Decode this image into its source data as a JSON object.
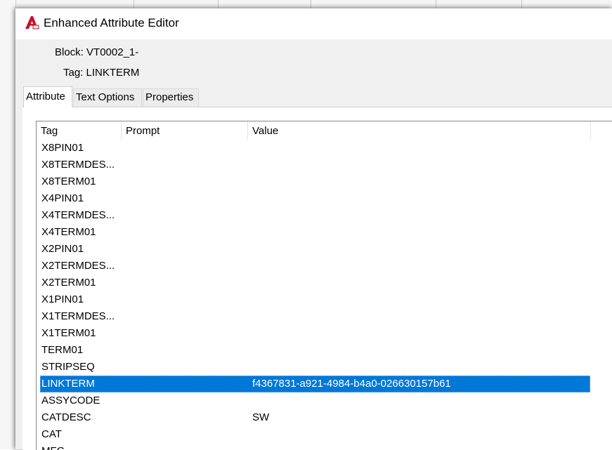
{
  "window": {
    "title": "Enhanced Attribute Editor",
    "app_icon": "autocad-icon"
  },
  "info": {
    "block_label": "Block:",
    "block_value": "VT0002_1-",
    "tag_label": "Tag:",
    "tag_value": "LINKTERM"
  },
  "tabs": [
    {
      "label": "Attribute",
      "active": true
    },
    {
      "label": "Text Options",
      "active": false
    },
    {
      "label": "Properties",
      "active": false
    }
  ],
  "table": {
    "columns": [
      "Tag",
      "Prompt",
      "Value"
    ],
    "rows": [
      {
        "tag": "X8PIN01",
        "prompt": "",
        "value": ""
      },
      {
        "tag": "X8TERMDES...",
        "prompt": "",
        "value": ""
      },
      {
        "tag": "X8TERM01",
        "prompt": "",
        "value": ""
      },
      {
        "tag": "X4PIN01",
        "prompt": "",
        "value": ""
      },
      {
        "tag": "X4TERMDES...",
        "prompt": "",
        "value": ""
      },
      {
        "tag": "X4TERM01",
        "prompt": "",
        "value": ""
      },
      {
        "tag": "X2PIN01",
        "prompt": "",
        "value": ""
      },
      {
        "tag": "X2TERMDES...",
        "prompt": "",
        "value": ""
      },
      {
        "tag": "X2TERM01",
        "prompt": "",
        "value": ""
      },
      {
        "tag": "X1PIN01",
        "prompt": "",
        "value": ""
      },
      {
        "tag": "X1TERMDES...",
        "prompt": "",
        "value": ""
      },
      {
        "tag": "X1TERM01",
        "prompt": "",
        "value": ""
      },
      {
        "tag": "TERM01",
        "prompt": "",
        "value": ""
      },
      {
        "tag": "STRIPSEQ",
        "prompt": "",
        "value": ""
      },
      {
        "tag": "LINKTERM",
        "prompt": "",
        "value": "f4367831-a921-4984-b4a0-026630157b61",
        "selected": true
      },
      {
        "tag": "ASSYCODE",
        "prompt": "",
        "value": ""
      },
      {
        "tag": "CATDESC",
        "prompt": "",
        "value": "SW"
      },
      {
        "tag": "CAT",
        "prompt": "",
        "value": ""
      },
      {
        "tag": "MFG",
        "prompt": "",
        "value": ""
      }
    ]
  },
  "colors": {
    "selection": "#0078d7",
    "accent_icon": "#c8102e"
  }
}
